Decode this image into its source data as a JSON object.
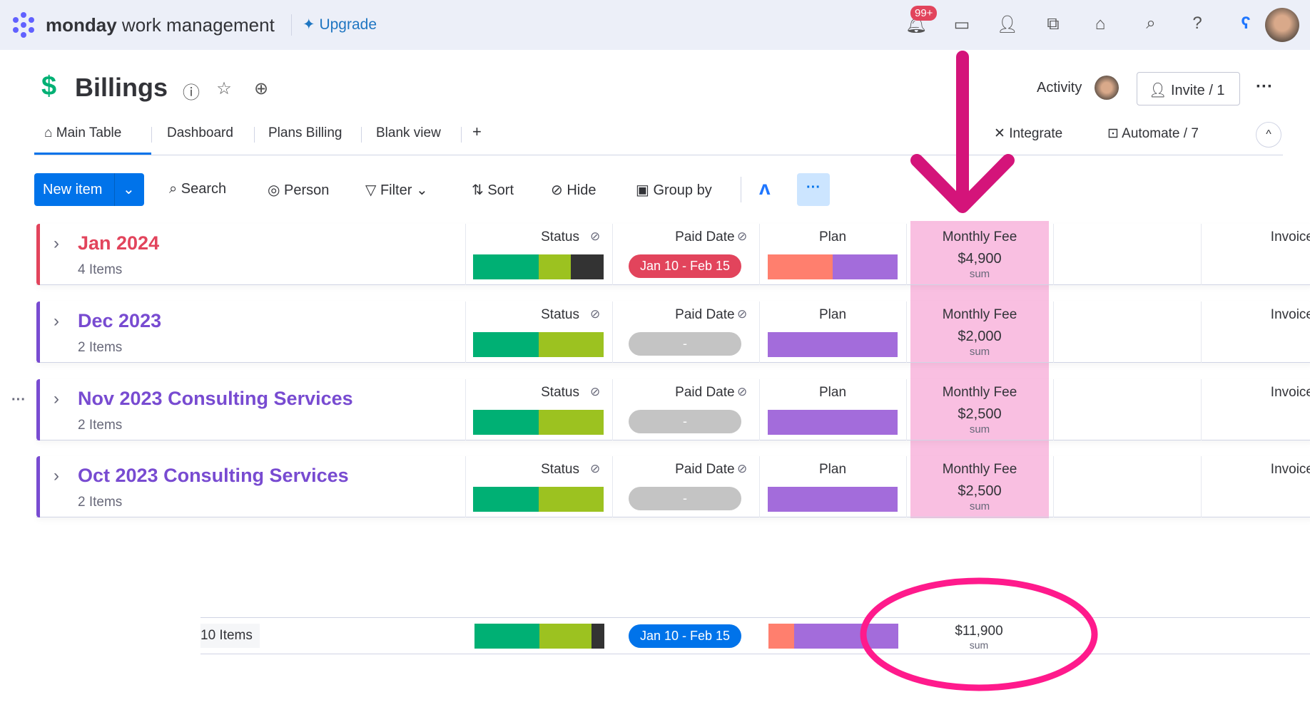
{
  "topbar": {
    "brand_bold": "monday",
    "brand_rest": "work management",
    "upgrade": "Upgrade",
    "notif_badge": "99+"
  },
  "board": {
    "title": "Billings",
    "activity": "Activity",
    "invite": "Invite / 1"
  },
  "tabs": [
    {
      "label": "Main Table"
    },
    {
      "label": "Dashboard"
    },
    {
      "label": "Plans Billing"
    },
    {
      "label": "Blank view"
    }
  ],
  "tab_add": "+",
  "views_right": {
    "integrate": "Integrate",
    "automate": "Automate / 7"
  },
  "toolbar": {
    "new_item": "New item",
    "search": "Search",
    "person": "Person",
    "filter": "Filter",
    "sort": "Sort",
    "hide": "Hide",
    "group_by": "Group by"
  },
  "columns": {
    "status": "Status",
    "paid_date": "Paid Date",
    "plan": "Plan",
    "monthly_fee": "Monthly Fee",
    "invoice": "Invoice"
  },
  "colors": {
    "done": "#00b074",
    "working": "#9cc220",
    "stuck": "#333333",
    "plan_a": "#ff7f6e",
    "plan_b": "#a36cdb",
    "highlight": "#f9bfe1",
    "annotation": "#e0157f"
  },
  "groups": [
    {
      "name": "Jan 2024",
      "count": "4 Items",
      "color": "#e2445c",
      "status": [
        0.5,
        0.25,
        0.25
      ],
      "paid_date": "Jan 10 - Feb 15",
      "paid_color": "#e2445c",
      "plan": [
        0.5,
        0.5
      ],
      "fee": "$4,900",
      "fee_label": "sum"
    },
    {
      "name": "Dec 2023",
      "count": "2 Items",
      "color": "#784bd1",
      "status": [
        0.5,
        0.5,
        0
      ],
      "paid_date": "-",
      "paid_color": "#c4c4c4",
      "plan": [
        0,
        1
      ],
      "fee": "$2,000",
      "fee_label": "sum"
    },
    {
      "name": "Nov 2023 Consulting Services",
      "count": "2 Items",
      "color": "#784bd1",
      "status": [
        0.5,
        0.5,
        0
      ],
      "paid_date": "-",
      "paid_color": "#c4c4c4",
      "plan": [
        0,
        1
      ],
      "fee": "$2,500",
      "fee_label": "sum"
    },
    {
      "name": "Oct 2023 Consulting Services",
      "count": "2 Items",
      "color": "#784bd1",
      "status": [
        0.5,
        0.5,
        0
      ],
      "paid_date": "-",
      "paid_color": "#c4c4c4",
      "plan": [
        0,
        1
      ],
      "fee": "$2,500",
      "fee_label": "sum"
    }
  ],
  "summary": {
    "count": "10 Items",
    "status": [
      0.5,
      0.4,
      0.1
    ],
    "paid_date": "Jan 10 - Feb 15",
    "plan": [
      0.2,
      0.8
    ],
    "fee": "$11,900",
    "fee_label": "sum"
  }
}
